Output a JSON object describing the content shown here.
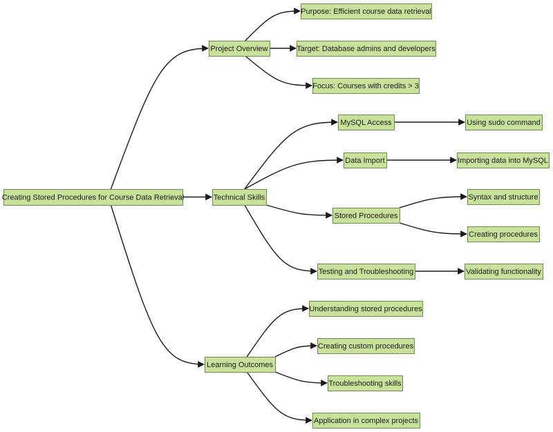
{
  "diagram": {
    "type": "mindmap-flow",
    "style": {
      "node_fill": "#c8e29b",
      "node_stroke": "#6e8a4a",
      "edge_color": "#1a1a1a"
    },
    "nodes": [
      {
        "id": "root",
        "label": "Creating Stored Procedures for Course Data Retrieval"
      },
      {
        "id": "overview",
        "label": "Project Overview"
      },
      {
        "id": "purpose",
        "label": "Purpose: Efficient course data retrieval"
      },
      {
        "id": "target",
        "label": "Target: Database admins and developers"
      },
      {
        "id": "focus",
        "label": "Focus: Courses with credits > 3"
      },
      {
        "id": "tech",
        "label": "Technical Skills"
      },
      {
        "id": "mysql",
        "label": "MySQL Access"
      },
      {
        "id": "sudo",
        "label": "Using sudo command"
      },
      {
        "id": "import",
        "label": "Data Import"
      },
      {
        "id": "importing",
        "label": "Importing data into MySQL"
      },
      {
        "id": "sp",
        "label": "Stored Procedures"
      },
      {
        "id": "syntax",
        "label": "Syntax and structure"
      },
      {
        "id": "creating",
        "label": "Creating procedures"
      },
      {
        "id": "testing",
        "label": "Testing and Troubleshooting"
      },
      {
        "id": "validating",
        "label": "Validating functionality"
      },
      {
        "id": "learning",
        "label": "Learning Outcomes"
      },
      {
        "id": "understanding",
        "label": "Understanding stored procedures"
      },
      {
        "id": "custom",
        "label": "Creating custom procedures"
      },
      {
        "id": "troubleshooting",
        "label": "Troubleshooting skills"
      },
      {
        "id": "application",
        "label": "Application in complex projects"
      }
    ],
    "edges": [
      {
        "from": "root",
        "to": "overview"
      },
      {
        "from": "root",
        "to": "tech"
      },
      {
        "from": "root",
        "to": "learning"
      },
      {
        "from": "overview",
        "to": "purpose"
      },
      {
        "from": "overview",
        "to": "target"
      },
      {
        "from": "overview",
        "to": "focus"
      },
      {
        "from": "tech",
        "to": "mysql"
      },
      {
        "from": "tech",
        "to": "import"
      },
      {
        "from": "tech",
        "to": "sp"
      },
      {
        "from": "tech",
        "to": "testing"
      },
      {
        "from": "mysql",
        "to": "sudo"
      },
      {
        "from": "import",
        "to": "importing"
      },
      {
        "from": "sp",
        "to": "syntax"
      },
      {
        "from": "sp",
        "to": "creating"
      },
      {
        "from": "testing",
        "to": "validating"
      },
      {
        "from": "learning",
        "to": "understanding"
      },
      {
        "from": "learning",
        "to": "custom"
      },
      {
        "from": "learning",
        "to": "troubleshooting"
      },
      {
        "from": "learning",
        "to": "application"
      }
    ]
  }
}
